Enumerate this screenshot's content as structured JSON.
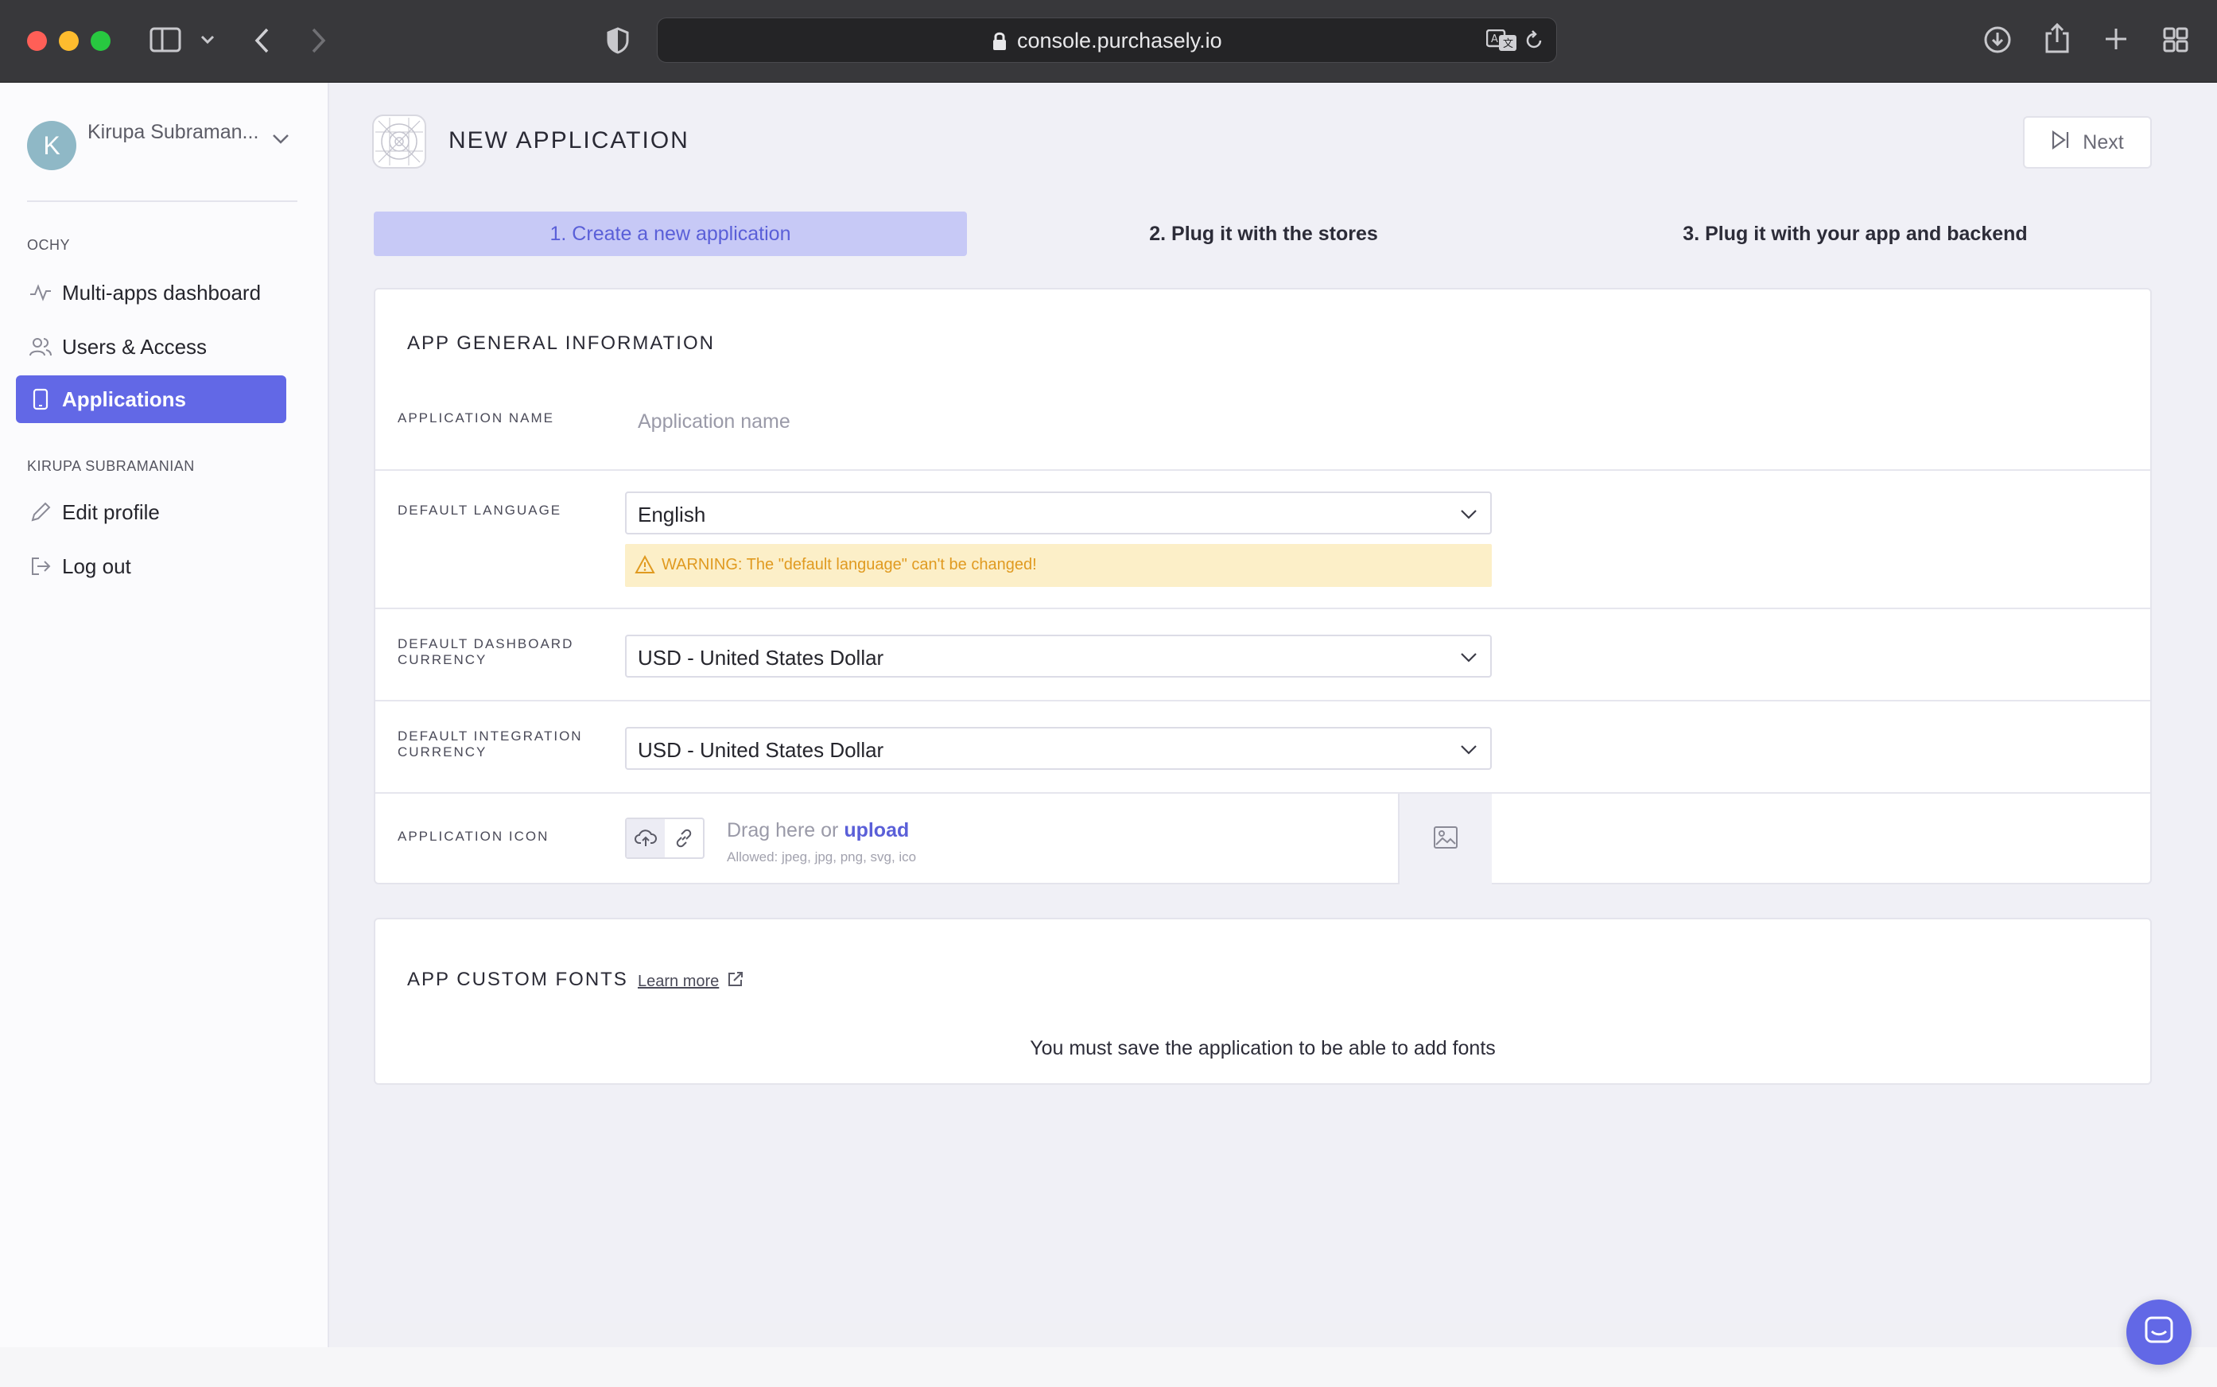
{
  "browser": {
    "url": "console.purchasely.io"
  },
  "sidebar": {
    "user_name": "Kirupa Subraman...",
    "avatar_initial": "K",
    "section_org": "OCHY",
    "items": [
      {
        "label": "Multi-apps dashboard",
        "icon": "activity-icon"
      },
      {
        "label": "Users & Access",
        "icon": "users-icon"
      },
      {
        "label": "Applications",
        "icon": "phone-icon"
      }
    ],
    "section_user": "KIRUPA SUBRAMANIAN",
    "user_items": [
      {
        "label": "Edit profile",
        "icon": "pencil-icon"
      },
      {
        "label": "Log out",
        "icon": "logout-icon"
      }
    ]
  },
  "header": {
    "title": "NEW APPLICATION",
    "next_label": "Next"
  },
  "steps": [
    {
      "label": "1. Create a new application",
      "active": true
    },
    {
      "label": "2. Plug it with the stores",
      "active": false
    },
    {
      "label": "3. Plug it with your app and backend",
      "active": false
    }
  ],
  "general": {
    "title": "APP GENERAL INFORMATION",
    "app_name_label": "APPLICATION NAME",
    "app_name_placeholder": "Application name",
    "language_label": "DEFAULT LANGUAGE",
    "language_value": "English",
    "language_warning": "WARNING: The \"default language\" can't be changed!",
    "dashboard_currency_label": "DEFAULT DASHBOARD CURRENCY",
    "dashboard_currency_value": "USD - United States Dollar",
    "integration_currency_label": "DEFAULT INTEGRATION CURRENCY",
    "integration_currency_value": "USD - United States Dollar",
    "icon_label": "APPLICATION ICON",
    "drag_text": "Drag here or",
    "upload_link": "upload",
    "allowed_text": "Allowed: jpeg, jpg, png, svg, ico"
  },
  "fonts": {
    "title": "APP CUSTOM FONTS",
    "learn_more": "Learn more",
    "message": "You must save the application to be able to add fonts"
  },
  "colors": {
    "accent": "#6268e6",
    "step_active_bg": "#c7c9f6",
    "warning_bg": "#fcefc8",
    "warning_text": "#e09a20"
  }
}
